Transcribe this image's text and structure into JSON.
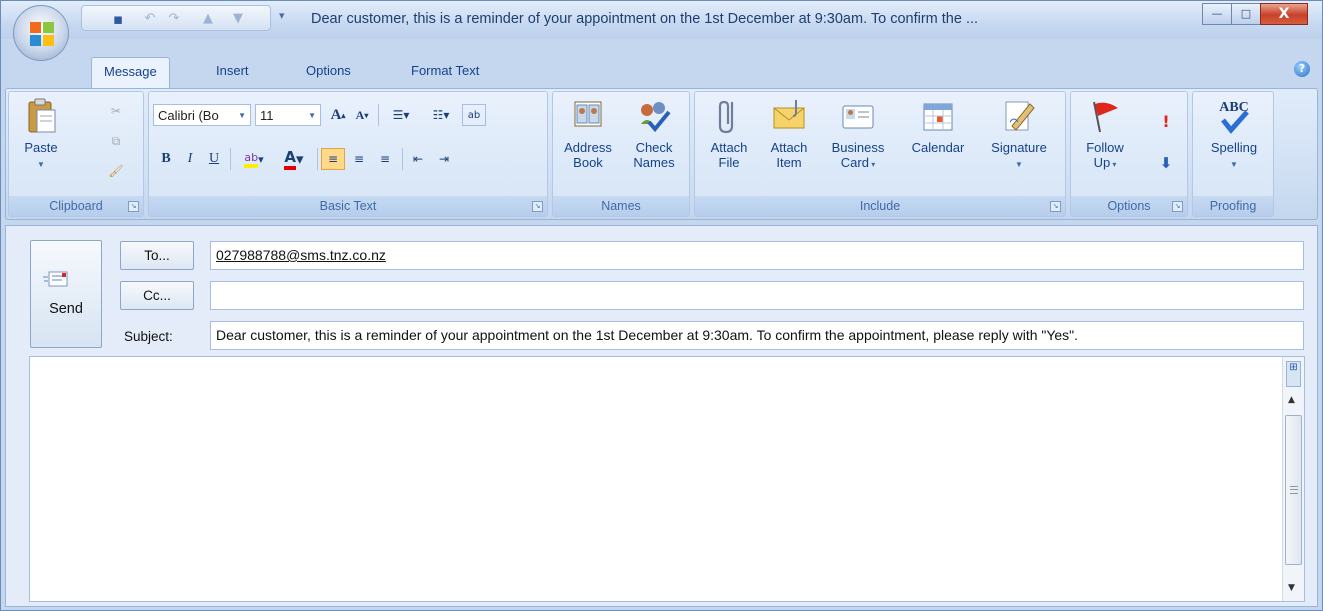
{
  "window": {
    "title": "Dear customer, this is a reminder of your appointment on the 1st December at 9:30am. To confirm the ...",
    "controls": {
      "minimize": "—",
      "maximize": "□",
      "close": "X"
    }
  },
  "tabs": [
    "Message",
    "Insert",
    "Options",
    "Format Text"
  ],
  "active_tab": "Message",
  "ribbon": {
    "clipboard": {
      "label": "Clipboard",
      "paste": "Paste"
    },
    "basic_text": {
      "label": "Basic Text",
      "font": "Calibri (Bo",
      "size": "11"
    },
    "names": {
      "label": "Names",
      "address_book": [
        "Address",
        "Book"
      ],
      "check_names": [
        "Check",
        "Names"
      ]
    },
    "include": {
      "label": "Include",
      "attach_file": [
        "Attach",
        "File"
      ],
      "attach_item": [
        "Attach",
        "Item"
      ],
      "business_card": [
        "Business",
        "Card"
      ],
      "calendar": "Calendar",
      "signature": "Signature"
    },
    "options": {
      "label": "Options",
      "follow_up": [
        "Follow",
        "Up"
      ]
    },
    "proofing": {
      "label": "Proofing",
      "spelling": "Spelling",
      "icon_text": "ABC"
    }
  },
  "compose": {
    "send": "Send",
    "to_button": "To...",
    "cc_button": "Cc...",
    "subject_label": "Subject:",
    "to_value": "027988788@sms.tnz.co.nz",
    "cc_value": "",
    "subject_value": "Dear customer, this is a reminder of your appointment on the 1st December at 9:30am. To confirm the appointment, please reply with \"Yes\".",
    "body": ""
  },
  "colors": {
    "accent": "#15428b",
    "ribbon": "#d9e7f7",
    "highlight": "#ffee00",
    "font_color": "#e00000"
  }
}
